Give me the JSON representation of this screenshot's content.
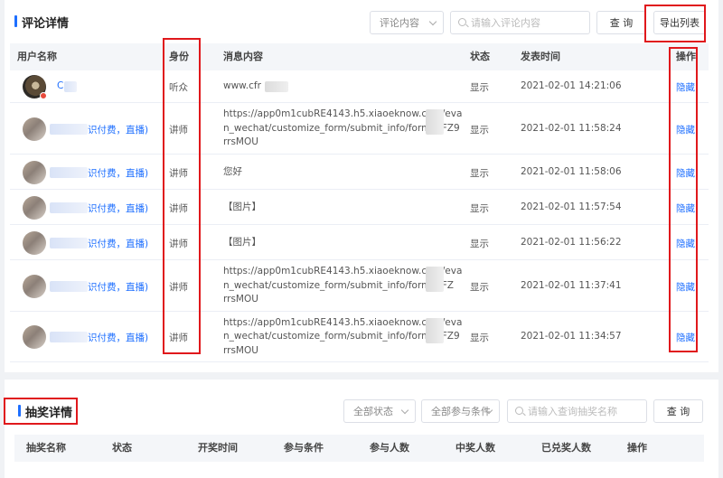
{
  "comments": {
    "title": "评论详情",
    "filter_select": "评论内容",
    "search_placeholder": "请输入评论内容",
    "search_button": "查 询",
    "export_button": "导出列表",
    "columns": [
      "用户名称",
      "身份",
      "消息内容",
      "状态",
      "发表时间",
      "操作"
    ],
    "rows": [
      {
        "user": "C",
        "role": "听众",
        "message": [
          "www.cfr"
        ],
        "status": "显示",
        "time": "2021-02-01 14:21:06",
        "action": "隐藏"
      },
      {
        "user": "识付费，直播)",
        "role": "讲师",
        "message": [
          "https://app0m1cubRE4143.h5.xiaoeknow.com/eva",
          "n_wechat/customize_form/submit_info/form_ZFZ9",
          "rrsMOU"
        ],
        "status": "显示",
        "time": "2021-02-01 11:58:24",
        "action": "隐藏"
      },
      {
        "user": "识付费，直播)",
        "role": "讲师",
        "message": [
          "您好"
        ],
        "status": "显示",
        "time": "2021-02-01 11:58:06",
        "action": "隐藏"
      },
      {
        "user": "识付费，直播)",
        "role": "讲师",
        "message": [
          "【图片】"
        ],
        "status": "显示",
        "time": "2021-02-01 11:57:54",
        "action": "隐藏"
      },
      {
        "user": "识付费，直播)",
        "role": "讲师",
        "message": [
          "【图片】"
        ],
        "status": "显示",
        "time": "2021-02-01 11:56:22",
        "action": "隐藏"
      },
      {
        "user": "识付费，直播)",
        "role": "讲师",
        "message": [
          "https://app0m1cubRE4143.h5.xiaoeknow.com/eva",
          "n_wechat/customize_form/submit_info/form_ZFZ",
          "rrsMOU"
        ],
        "status": "显示",
        "time": "2021-02-01 11:37:41",
        "action": "隐藏"
      },
      {
        "user": "识付费，直播)",
        "role": "讲师",
        "message": [
          "https://app0m1cubRE4143.h5.xiaoeknow.com/eva",
          "n_wechat/customize_form/submit_info/form_ZFZ9",
          "rrsMOU"
        ],
        "status": "显示",
        "time": "2021-02-01 11:34:57",
        "action": "隐藏"
      }
    ]
  },
  "lottery": {
    "title": "抽奖详情",
    "status_select": "全部状态",
    "condition_select": "全部参与条件",
    "search_placeholder": "请输入查询抽奖名称",
    "search_button": "查 询",
    "columns": [
      "抽奖名称",
      "状态",
      "开奖时间",
      "参与条件",
      "参与人数",
      "中奖人数",
      "已兑奖人数",
      "操作"
    ]
  },
  "colors": {
    "accent": "#1e6fff",
    "annotation": "#e0181c"
  }
}
